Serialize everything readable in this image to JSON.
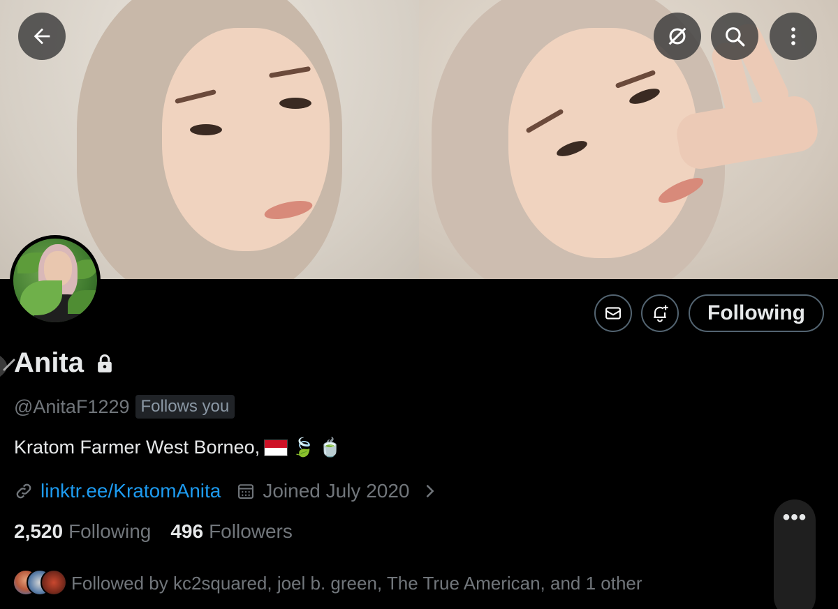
{
  "header": {
    "back_icon": "arrow-left-icon",
    "grok_icon": "slash-circle-icon",
    "search_icon": "search-icon",
    "more_icon": "more-vertical-icon"
  },
  "actions": {
    "message_icon": "envelope-icon",
    "notify_icon": "bell-plus-icon",
    "follow_label": "Following"
  },
  "profile": {
    "name": "Anita",
    "locked_icon": "lock-icon",
    "handle": "@AnitaF1229",
    "follows_you": "Follows you",
    "bio_text": "Kratom Farmer West Borneo,",
    "bio_emoji_leaf": "🍃",
    "bio_emoji_tea": "🍵",
    "link": "linktr.ee/KratomAnita",
    "joined": "Joined July 2020",
    "following_count": "2,520",
    "following_label": "Following",
    "followers_count": "496",
    "followers_label": "Followers",
    "followed_by": "Followed by kc2squared, joel b. green, The True American, and 1 other"
  },
  "floating": {
    "more_label": "•••"
  },
  "colors": {
    "background": "#000000",
    "text_primary": "#e7e9ea",
    "text_secondary": "#71767b",
    "link": "#1d9bf0",
    "border": "#536471",
    "flag_red": "#ce1126"
  }
}
